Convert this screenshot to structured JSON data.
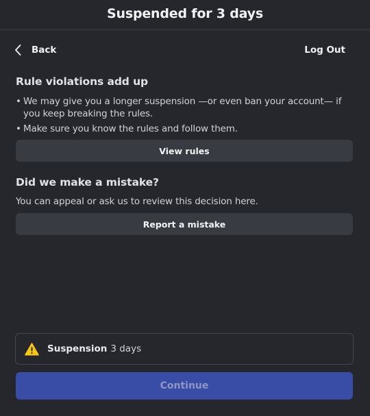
{
  "header": {
    "title": "Suspended for 3 days"
  },
  "nav": {
    "back_label": "Back",
    "logout_label": "Log Out"
  },
  "rules_section": {
    "heading": "Rule violations add up",
    "bullets": [
      "We may give you a longer suspension —or even ban your account— if you keep breaking the rules.",
      "Make sure you know the rules and follow them."
    ],
    "bullet_marker": "•",
    "view_rules_label": "View rules"
  },
  "mistake_section": {
    "heading": "Did we make a mistake?",
    "text": "You can appeal or ask us to review this decision here.",
    "report_label": "Report a mistake"
  },
  "suspension": {
    "label": "Suspension",
    "value": "3 days",
    "icon": "warning-icon",
    "icon_color": "#f5c518"
  },
  "footer": {
    "continue_label": "Continue",
    "continue_enabled": false,
    "accent_color": "#3a4da6"
  }
}
